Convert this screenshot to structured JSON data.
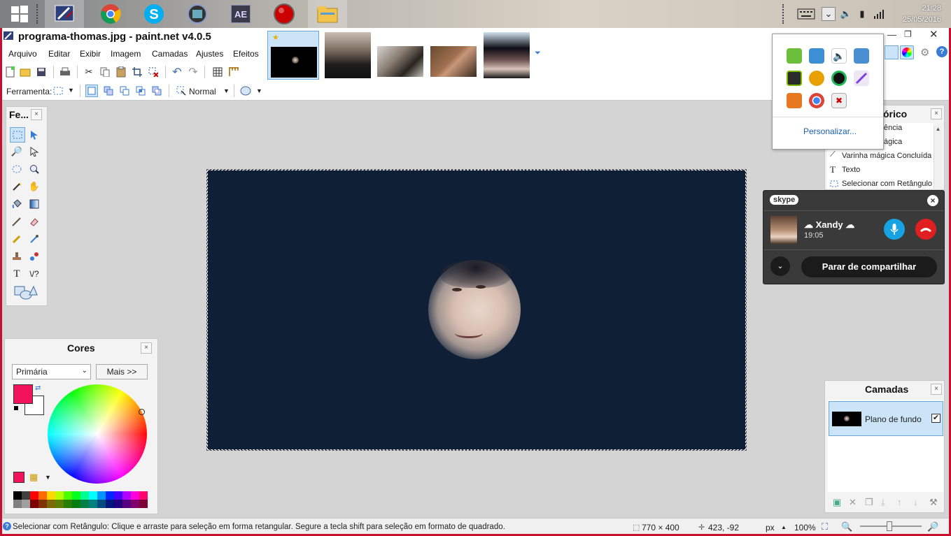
{
  "taskbar": {
    "clock_time": "21:28",
    "clock_date": "25/05/2016",
    "apps": [
      "windows-start-icon",
      "paint-net-icon",
      "chrome-icon",
      "skype-icon",
      "video-icon",
      "after-effects-icon",
      "record-icon",
      "file-explorer-icon"
    ],
    "ae_label": "AE"
  },
  "app": {
    "title": "programa-thomas.jpg - paint.net v4.0.5"
  },
  "menu": {
    "items": [
      "Arquivo",
      "Editar",
      "Exibir",
      "Imagem",
      "Camadas",
      "Ajustes",
      "Efeitos"
    ]
  },
  "toolbar2": {
    "tool_label": "Ferramenta:",
    "blend_mode": "Normal"
  },
  "tools_panel": {
    "title": "Fe...",
    "close": "×"
  },
  "history_panel": {
    "title": "órico",
    "close": "×",
    "items": [
      "ência",
      "ágica",
      "Varinha mágica Concluída",
      "Texto",
      "Selecionar com Retângulo"
    ]
  },
  "tray_popup": {
    "customize": "Personalizar..."
  },
  "skype": {
    "logo": "skype",
    "close": "×",
    "contact_name": "☁ Xandy ☁",
    "call_time": "19:05",
    "stop_sharing": "Parar de compartilhar"
  },
  "colors_panel": {
    "title": "Cores",
    "close": "×",
    "mode_select": "Primária",
    "more_button": "Mais >>",
    "primary_color": "#f2135a",
    "secondary_color": "#ffffff"
  },
  "layers_panel": {
    "title": "Camadas",
    "close": "×",
    "layers": [
      {
        "name": "Plano de fundo",
        "visible": true
      }
    ]
  },
  "statusbar": {
    "hint": "Selecionar com Retângulo: Clique e arraste para seleção em forma retangular. Segure a tecla shift para seleção em formato de quadrado.",
    "selection_size": "770 × 400",
    "cursor_pos": "423, -92",
    "unit": "px",
    "zoom": "100%"
  },
  "palette": [
    "#000000",
    "#404040",
    "#ff0000",
    "#ff6a00",
    "#ffd800",
    "#b6ff00",
    "#4cff00",
    "#00ff21",
    "#00ff90",
    "#00ffff",
    "#0094ff",
    "#0026ff",
    "#4800ff",
    "#b200ff",
    "#ff00dc",
    "#ff006e"
  ],
  "palette_dark": [
    "#808080",
    "#a0a0a0",
    "#7f0000",
    "#7f3300",
    "#7f6a00",
    "#5b7f00",
    "#267f00",
    "#007f0e",
    "#007f46",
    "#007f7f",
    "#004a7f",
    "#00137f",
    "#21007f",
    "#57007f",
    "#7f006e",
    "#7f0037"
  ]
}
